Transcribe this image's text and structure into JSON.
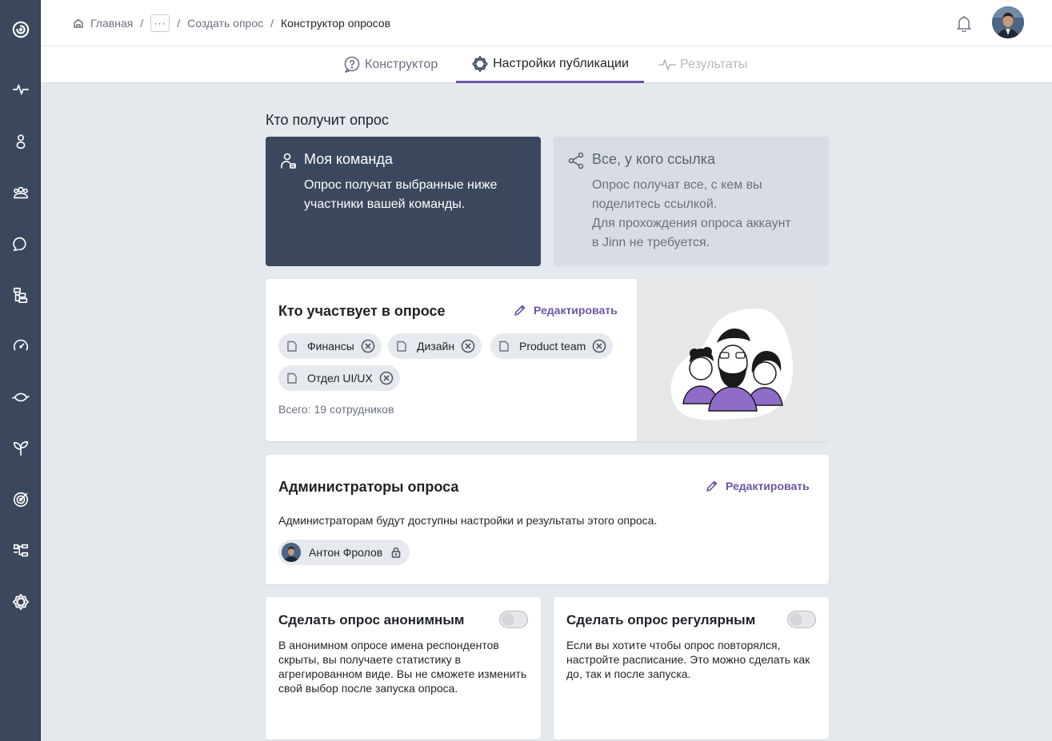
{
  "breadcrumb": {
    "home": "Главная",
    "more": "···",
    "create": "Создать опрос",
    "current": "Конструктор опросов",
    "separator": "/"
  },
  "sidebar": {
    "items": [
      "logo-icon",
      "pulse-icon",
      "person-icon",
      "team-icon",
      "chat-icon",
      "org-chart-icon",
      "speedometer-icon",
      "sync-icon",
      "sprout-icon",
      "target-icon",
      "workflow-icon",
      "settings-icon"
    ]
  },
  "tabs": [
    {
      "label": "Конструктор",
      "state": "inactive"
    },
    {
      "label": "Настройки публикации",
      "state": "active"
    },
    {
      "label": "Результаты",
      "state": "disabled"
    }
  ],
  "recipients": {
    "title": "Кто получит опрос",
    "team": {
      "title": "Моя команда",
      "desc": "Опрос получат выбранные ниже\nучастники вашей команды."
    },
    "link": {
      "title": "Все, у кого ссылка",
      "desc": "Опрос получат все, с кем вы\nподелитесь ссылкой.\nДля прохождения опроса аккаунт\nв Jinn не требуется."
    }
  },
  "participants": {
    "title": "Кто участвует в опросе",
    "edit_label": "Редактировать",
    "chips": [
      "Финансы",
      "Дизайн",
      "Product team",
      "Отдел UI/UX"
    ],
    "total": "Всего: 19 сотрудников"
  },
  "admins": {
    "title": "Администраторы опроса",
    "edit_label": "Редактировать",
    "desc": "Администраторам будут доступны настройки и результаты этого опроса.",
    "users": [
      "Антон Фролов"
    ]
  },
  "anonymous": {
    "title": "Сделать опрос анонимным",
    "enabled": false,
    "desc": "В анонимном опросе имена респондентов скрыты, вы получаете статистику в агрегированном виде. Вы не сможете изменить свой выбор после запуска опроса."
  },
  "regular": {
    "title": "Сделать опрос регулярным",
    "enabled": false,
    "desc": "Если вы хотите чтобы опрос повторялся, настройте расписание. Это можно сделать как до, так и после запуска."
  },
  "colors": {
    "accent": "#6e55a8",
    "sidebar": "#3b475c",
    "background": "#e4e9ee"
  }
}
